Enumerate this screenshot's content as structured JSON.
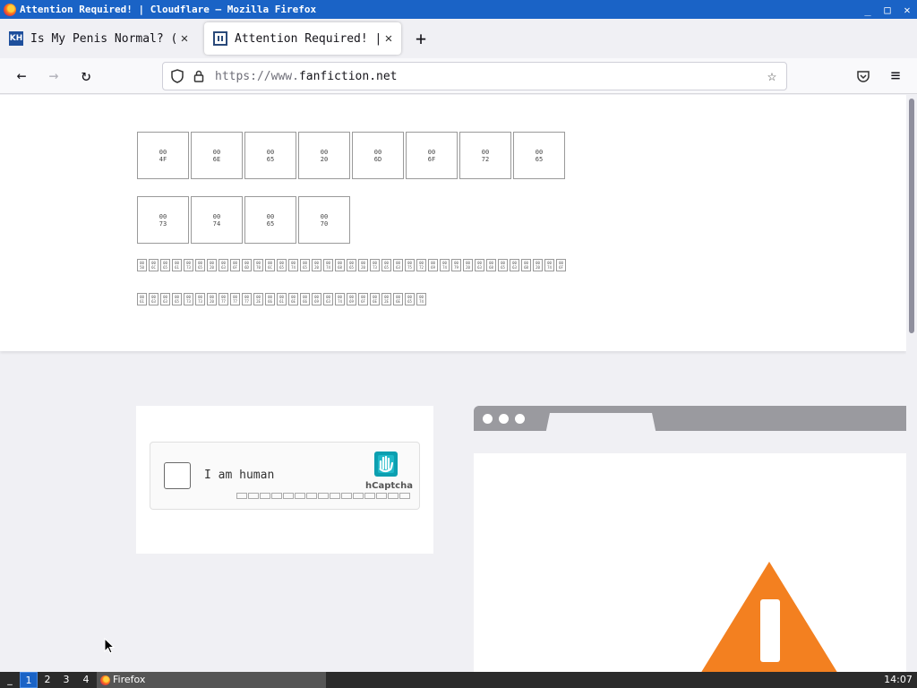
{
  "window": {
    "title": "Attention Required! | Cloudflare — Mozilla Firefox",
    "minimize": "_",
    "maximize": "□",
    "close": "✕"
  },
  "tabs": [
    {
      "label": "Is My Penis Normal? (for",
      "favicon": "kh-icon",
      "close": "✕"
    },
    {
      "label": "Attention Required! | Cl",
      "favicon": "document-icon",
      "close": "✕",
      "active": true
    }
  ],
  "newtab_label": "+",
  "nav": {
    "back": "←",
    "forward": "→",
    "reload": "↻",
    "url_prefix": "https://www.",
    "url_host": "fanfiction.net",
    "shield_icon": "shield-icon",
    "lock_icon": "lock-icon",
    "bookmark": "☆",
    "pocket_icon": "pocket-icon",
    "menu": "≡"
  },
  "page": {
    "heading_glyphs_row1": [
      "00\n4F",
      "00\n6E",
      "00\n65",
      "00\n20",
      "00\n6D",
      "00\n6F",
      "00\n72",
      "00\n65"
    ],
    "heading_glyphs_row2": [
      "00\n73",
      "00\n74",
      "00\n65",
      "00\n70"
    ],
    "body_glyphs_line1": [
      "00\n50",
      "00\n6C",
      "00\n65",
      "00\n61",
      "00\n73",
      "00\n65",
      "00\n20",
      "00\n63",
      "00\n6F",
      "00\n6D",
      "00\n70",
      "00\n6C",
      "00\n65",
      "00\n74",
      "00\n65",
      "00\n20",
      "00\n74",
      "00\n68",
      "00\n65",
      "00\n20",
      "00\n73",
      "00\n65",
      "00\n63",
      "00\n75",
      "00\n72",
      "00\n69",
      "00\n74",
      "00\n79",
      "00\n20",
      "00\n63",
      "00\n68",
      "00\n65",
      "00\n63",
      "00\n6B",
      "00\n20",
      "00\n74",
      "00\n6F"
    ],
    "body_glyphs_line2": [
      "00\n61",
      "00\n63",
      "00\n63",
      "00\n65",
      "00\n73",
      "00\n73",
      "00\n20",
      "00\n77",
      "00\n77",
      "00\n77",
      "00\n2E",
      "00\n66",
      "00\n61",
      "00\n6E",
      "00\n66",
      "00\n69",
      "00\n63",
      "00\n74",
      "00\n69",
      "00\n6F",
      "00\n6E",
      "00\n2E",
      "00\n6E",
      "00\n65",
      "00\n74"
    ],
    "captcha": {
      "label": "I am human",
      "brand": "hCaptcha",
      "brand_icon": "hcaptcha-hand-icon"
    },
    "illustration_icon": "warning-triangle-icon"
  },
  "taskbar": {
    "menu": "_",
    "workspaces": [
      "1",
      "2",
      "3",
      "4"
    ],
    "active_workspace": "1",
    "app_label": "Firefox",
    "clock": "14:07"
  },
  "colors": {
    "titlebar": "#1a63c6",
    "warning": "#f38020",
    "hcaptcha": "#00838f"
  }
}
